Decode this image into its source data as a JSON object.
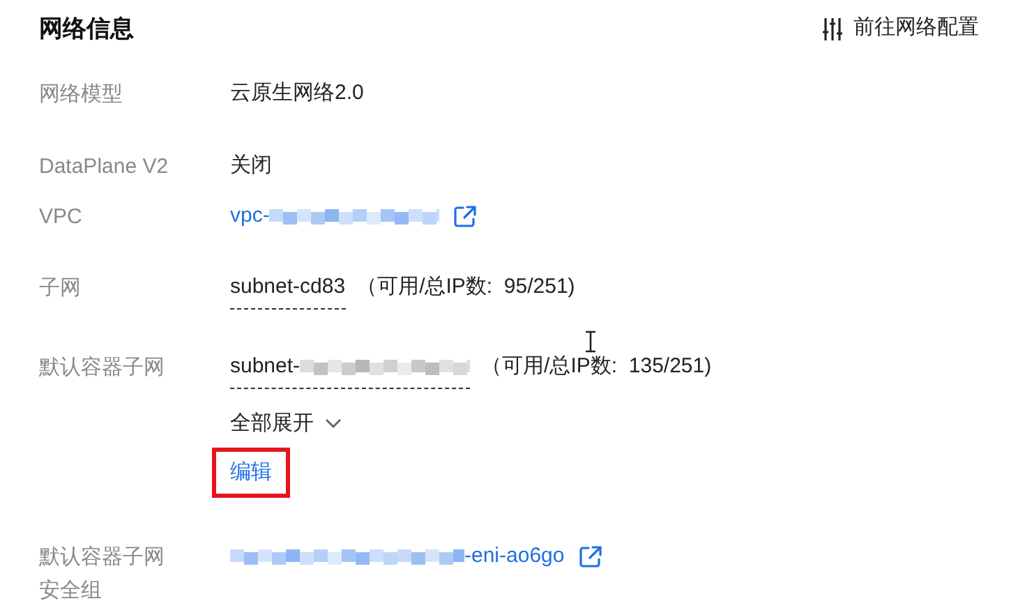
{
  "title": "网络信息",
  "action": {
    "label": "前往网络配置"
  },
  "rows": [
    {
      "label": "网络模型",
      "kind": "text",
      "parts": [
        {
          "kind": "text",
          "text": "云原生网络2.0"
        }
      ]
    },
    {
      "label": "DataPlane V2",
      "kind": "text",
      "parts": [
        {
          "kind": "text",
          "text": "关闭"
        }
      ]
    },
    {
      "label": "VPC",
      "kind": "link",
      "parts": [
        {
          "kind": "text",
          "text": "vpc-"
        },
        {
          "kind": "mask"
        }
      ],
      "external": true
    },
    {
      "label": "子网",
      "kind": "subnet",
      "parts": [
        {
          "kind": "text",
          "text": "subnet-cd83"
        }
      ],
      "note": "（可用/总IP数:  95/251)"
    },
    {
      "label": "默认容器子网",
      "kind": "subnet",
      "parts": [
        {
          "kind": "text",
          "text": "subnet-"
        },
        {
          "kind": "mask"
        }
      ],
      "note": "（可用/总IP数:  135/251)",
      "expand": {
        "label": "全部展开",
        "expanded": false
      },
      "edit": {
        "label": "编辑",
        "highlighted": true
      }
    },
    {
      "label": "默认容器子网安全组",
      "kind": "link",
      "parts": [
        {
          "kind": "mask"
        },
        {
          "kind": "text",
          "text": "-eni-ao6go"
        }
      ],
      "external": true
    }
  ]
}
